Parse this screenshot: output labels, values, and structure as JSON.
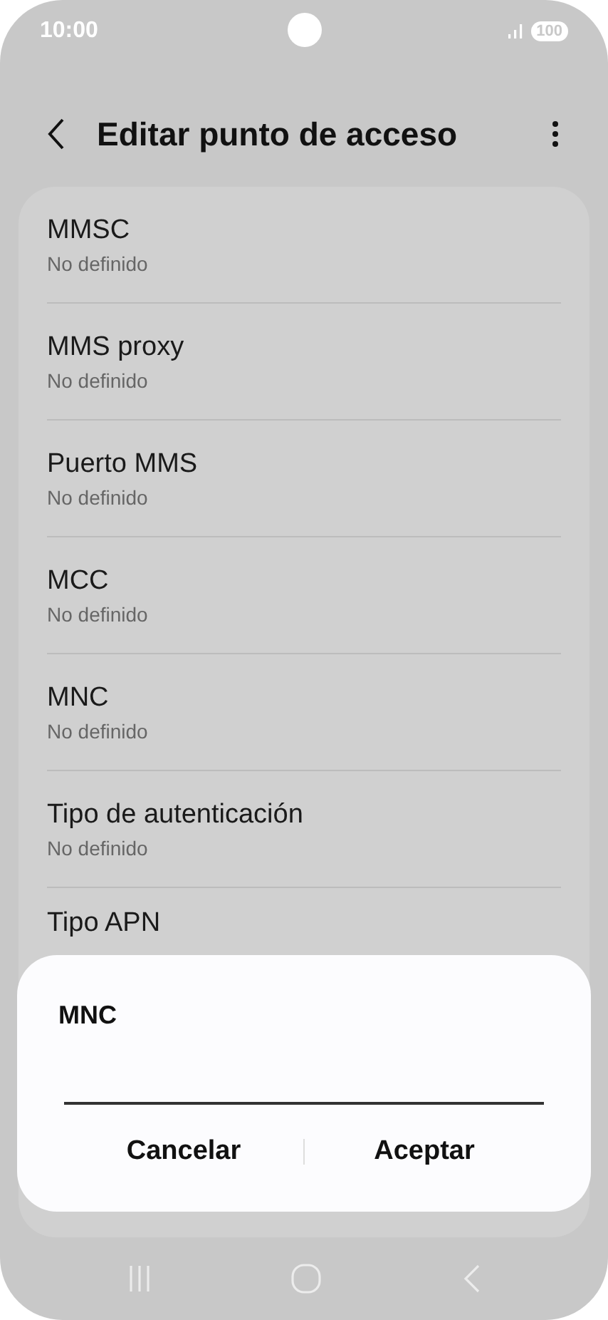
{
  "status_bar": {
    "time": "10:00",
    "battery": "100"
  },
  "header": {
    "title": "Editar punto de acceso"
  },
  "settings": [
    {
      "title": "MMSC",
      "value": "No definido"
    },
    {
      "title": "MMS proxy",
      "value": "No definido"
    },
    {
      "title": "Puerto MMS",
      "value": "No definido"
    },
    {
      "title": "MCC",
      "value": "No definido"
    },
    {
      "title": "MNC",
      "value": "No definido"
    },
    {
      "title": "Tipo de autenticación",
      "value": "No definido"
    },
    {
      "title": "Tipo APN"
    }
  ],
  "dialog": {
    "title": "MNC",
    "buttons": [
      "Cancelar",
      "Aceptar"
    ]
  }
}
